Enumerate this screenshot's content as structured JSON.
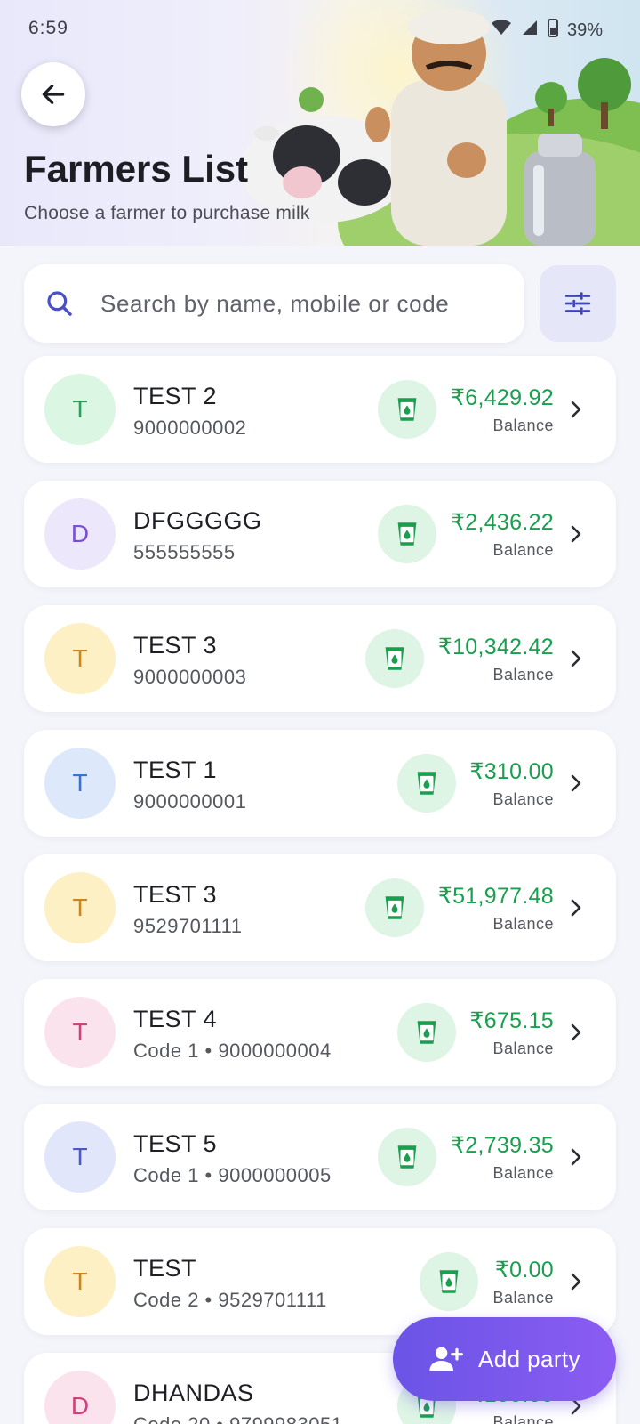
{
  "status_bar": {
    "time": "6:59",
    "battery": "39%"
  },
  "header": {
    "title": "Farmers List",
    "subtitle": "Choose a farmer to purchase milk"
  },
  "search": {
    "placeholder": "Search by name, mobile or code"
  },
  "colors": {
    "accent": "#6a54e6",
    "balance_green": "#1a9f4e",
    "card_bg": "#ffffff",
    "page_bg": "#f4f5fa"
  },
  "farmers": [
    {
      "initial": "T",
      "name": "TEST 2",
      "sub": "9000000002",
      "amount": "₹6,429.92",
      "balance_label": "Balance",
      "avatar_bg": "#dcf6e4",
      "avatar_fg": "#27a257"
    },
    {
      "initial": "D",
      "name": "DFGGGGG",
      "sub": "555555555",
      "amount": "₹2,436.22",
      "balance_label": "Balance",
      "avatar_bg": "#ece7fb",
      "avatar_fg": "#7a4fd0"
    },
    {
      "initial": "T",
      "name": "TEST 3",
      "sub": "9000000003",
      "amount": "₹10,342.42",
      "balance_label": "Balance",
      "avatar_bg": "#fdf0c4",
      "avatar_fg": "#d08316"
    },
    {
      "initial": "T",
      "name": "TEST 1",
      "sub": "9000000001",
      "amount": "₹310.00",
      "balance_label": "Balance",
      "avatar_bg": "#dde9fb",
      "avatar_fg": "#3b6fd8"
    },
    {
      "initial": "T",
      "name": "TEST 3",
      "sub": "9529701111",
      "amount": "₹51,977.48",
      "balance_label": "Balance",
      "avatar_bg": "#fdf0c4",
      "avatar_fg": "#d08316"
    },
    {
      "initial": "T",
      "name": "TEST 4",
      "sub": "Code 1 • 9000000004",
      "amount": "₹675.15",
      "balance_label": "Balance",
      "avatar_bg": "#fbe3ee",
      "avatar_fg": "#d0407a"
    },
    {
      "initial": "T",
      "name": "TEST 5",
      "sub": "Code 1 • 9000000005",
      "amount": "₹2,739.35",
      "balance_label": "Balance",
      "avatar_bg": "#e1e6fb",
      "avatar_fg": "#4a57d0"
    },
    {
      "initial": "T",
      "name": "TEST",
      "sub": "Code 2 • 9529701111",
      "amount": "₹0.00",
      "balance_label": "Balance",
      "avatar_bg": "#fdf0c4",
      "avatar_fg": "#d08316"
    },
    {
      "initial": "D",
      "name": "DHANDAS",
      "sub": "Code 20 • 9799983051",
      "amount": "₹100.00",
      "balance_label": "Balance",
      "avatar_bg": "#fbe3ee",
      "avatar_fg": "#d0407a"
    }
  ],
  "fab": {
    "label": "Add party",
    "icon": "person-add-icon"
  },
  "icons": {
    "back": "arrow-left-icon",
    "search": "search-icon",
    "filter": "sliders-icon",
    "milk": "milk-glass-icon",
    "chevron": "chevron-right-icon"
  }
}
